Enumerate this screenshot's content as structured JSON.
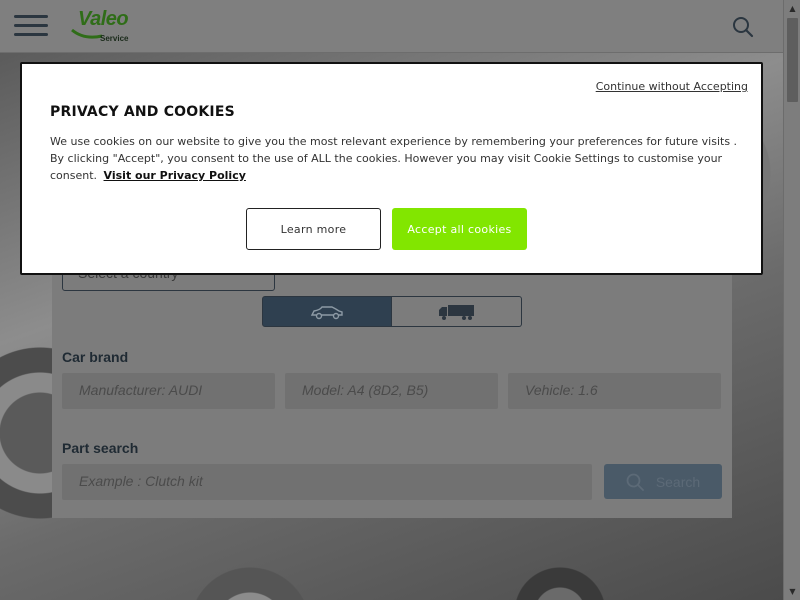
{
  "header": {
    "logo_text": "Valeo",
    "logo_subtext": "Service",
    "menu_icon": "hamburger-menu-icon",
    "search_icon": "search-icon"
  },
  "colors": {
    "brand_green": "#2f6d18",
    "accept_green": "#82e600",
    "dark_navy": "#2f4050"
  },
  "cookie_modal": {
    "continue_link": "Continue without Accepting",
    "title": "PRIVACY AND COOKIES",
    "body": "We use cookies on our website to give you the most relevant experience by remembering your preferences for future visits . By clicking \"Accept\", you consent to the use of ALL the cookies. However you may visit Cookie Settings to customise your consent.",
    "privacy_link": "Visit our Privacy Policy",
    "learn_more": "Learn more",
    "accept_all": "Accept all cookies"
  },
  "search_panel": {
    "country_placeholder": "Select a country",
    "vehicle_types": [
      {
        "icon": "car-icon",
        "active": true
      },
      {
        "icon": "truck-icon",
        "active": false
      }
    ],
    "car_brand_label": "Car brand",
    "manufacturer": "Manufacturer: AUDI",
    "model": "Model: A4 (8D2, B5)",
    "vehicle": "Vehicle: 1.6",
    "part_search_label": "Part search",
    "part_placeholder": "Example : Clutch kit",
    "search_button": "Search"
  }
}
